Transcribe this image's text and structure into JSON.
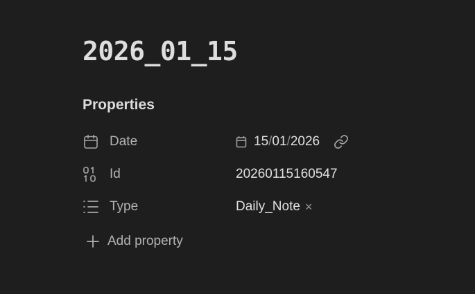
{
  "note": {
    "title": "2026_01_15"
  },
  "properties": {
    "heading": "Properties",
    "rows": [
      {
        "key": "Date",
        "icon": "calendar-icon",
        "value": {
          "day": "15",
          "month": "01",
          "year": "2026",
          "sep": "/"
        }
      },
      {
        "key": "Id",
        "icon": "binary-icon",
        "value": "20260115160547"
      },
      {
        "key": "Type",
        "icon": "list-icon",
        "value": "Daily_Note",
        "remove": "×"
      }
    ],
    "add_label": "Add property"
  }
}
